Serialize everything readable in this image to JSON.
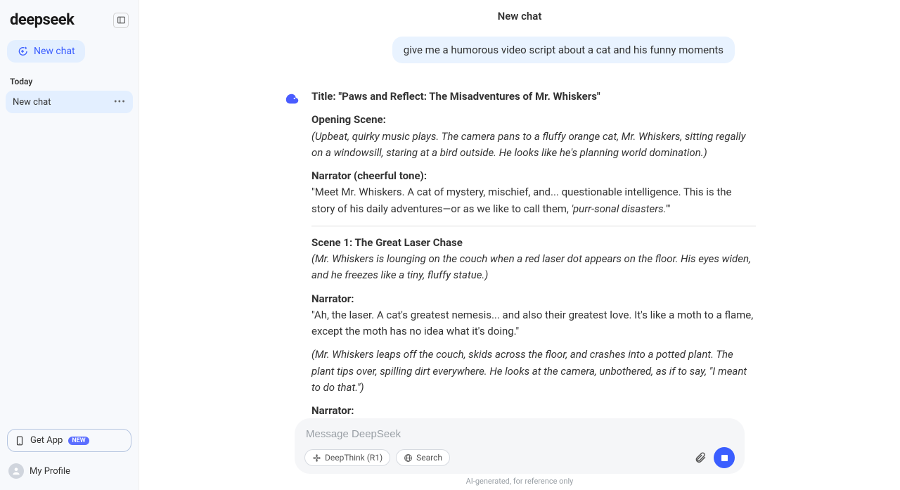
{
  "app": {
    "logo": "deepseek"
  },
  "sidebar": {
    "new_chat": "New chat",
    "section_today": "Today",
    "items": [
      {
        "label": "New chat"
      }
    ],
    "get_app": "Get App",
    "get_app_badge": "NEW",
    "profile": "My Profile"
  },
  "header": {
    "title": "New chat"
  },
  "chat": {
    "user_message": "give me a humorous video script about a cat and his funny moments",
    "title_label": "Title: \"Paws and Reflect: The Misadventures of Mr. Whiskers\"",
    "opening_label": "Opening Scene:",
    "opening_desc": "(Upbeat, quirky music plays. The camera pans to a fluffy orange cat, Mr. Whiskers, sitting regally on a windowsill, staring at a bird outside. He looks like he's planning world domination.)",
    "narr1_label": "Narrator (cheerful tone):",
    "narr1_a": "\"Meet Mr. Whiskers. A cat of mystery, mischief, and... questionable intelligence. This is the story of his daily adventures—or as we like to call them, ",
    "narr1_b": "'purr-sonal disasters.'",
    "narr1_c": "\"",
    "scene1_label": "Scene 1: The Great Laser Chase",
    "scene1_desc": "(Mr. Whiskers is lounging on the couch when a red laser dot appears on the floor. His eyes widen, and he freezes like a tiny, fluffy statue.)",
    "narr2_label": "Narrator:",
    "narr2_text": "\"Ah, the laser. A cat's greatest nemesis... and also their greatest love. It's like a moth to a flame, except the moth has no idea what it's doing.\"",
    "scene1_action": "(Mr. Whiskers leaps off the couch, skids across the floor, and crashes into a potted plant. The plant tips over, spilling dirt everywhere. He looks at the camera, unbothered, as if to say, \"I meant to do that.\")",
    "narr3_label": "Narrator:"
  },
  "composer": {
    "placeholder": "Message DeepSeek",
    "deepthink": "DeepThink (R1)",
    "search": "Search",
    "disclaimer": "AI-generated, for reference only"
  }
}
